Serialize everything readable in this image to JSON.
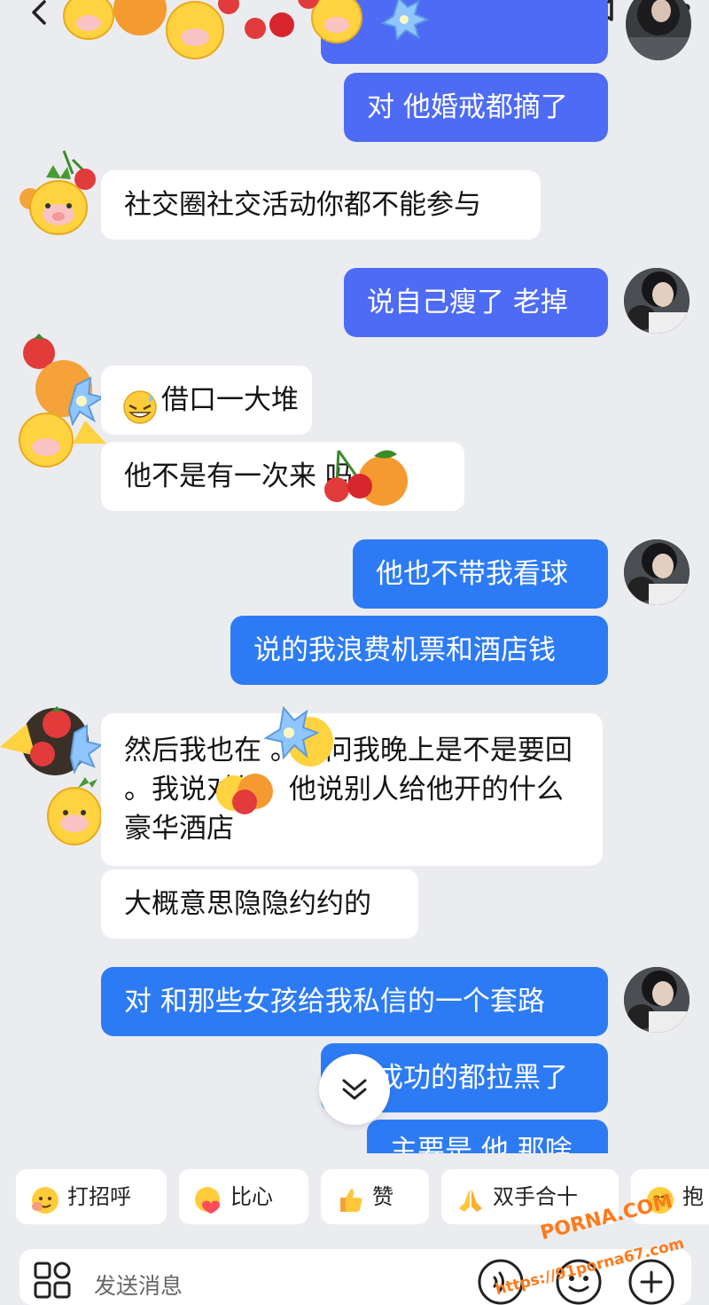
{
  "messages": [
    {
      "text": "对 他婚戒都摘了"
    },
    {
      "text": "社交圈社交活动你都不能参与"
    },
    {
      "text": "说自己瘦了 老掉"
    },
    {
      "text": "借口一大堆"
    },
    {
      "text": "他不是有一次来 吗。"
    },
    {
      "text": "他也不带我看球"
    },
    {
      "text": "说的我浪费机票和酒店钱"
    },
    {
      "text": "然后我也在 。他问我晚上是不是要回 。我说对的。他说别人给他开的什么豪华酒店"
    },
    {
      "text": "大概意思隐隐约约的"
    },
    {
      "text": "对 和那些女孩给我私信的一个套路"
    },
    {
      "text": "成功的都拉黑了"
    },
    {
      "text": "主要是 他 那啥"
    }
  ],
  "quick_replies": [
    {
      "label": "打招呼",
      "icon": "wave-emoji"
    },
    {
      "label": "比心",
      "icon": "heart-hands-emoji"
    },
    {
      "label": "赞",
      "icon": "thumbs-up-emoji"
    },
    {
      "label": "双手合十",
      "icon": "folded-hands-emoji"
    },
    {
      "label": "抱",
      "icon": "hug-emoji"
    }
  ],
  "input": {
    "placeholder": "发送消息"
  },
  "watermark": {
    "line1": "PORNA.COM",
    "line2": "https://91porna67.com"
  },
  "colors": {
    "background": "#ebecf0",
    "my_bubble": "#4e6bf6",
    "my_bubble_alt": "#2d7bf4",
    "their_bubble": "#ffffff",
    "watermark": "#ff7a1a"
  }
}
